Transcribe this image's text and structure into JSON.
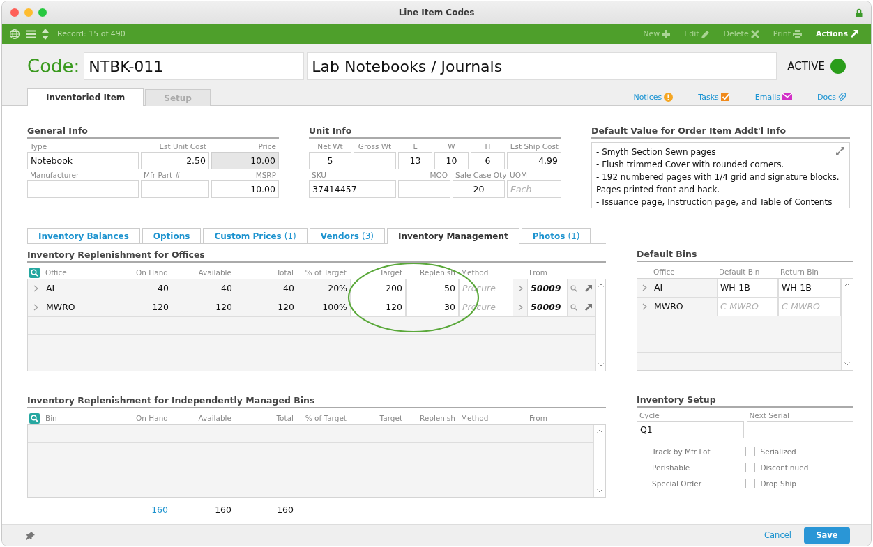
{
  "window": {
    "title": "Line Item Codes"
  },
  "toolbar": {
    "record": "Record: 15 of 490",
    "actions": [
      {
        "label": "New",
        "disabled": true
      },
      {
        "label": "Edit",
        "disabled": true
      },
      {
        "label": "Delete",
        "disabled": true
      },
      {
        "label": "Print",
        "disabled": true
      },
      {
        "label": "Actions",
        "disabled": false
      }
    ]
  },
  "header": {
    "code_label": "Code:",
    "code": "NTBK-011",
    "name": "Lab Notebooks / Journals",
    "status": "ACTIVE",
    "active": true
  },
  "main_tabs": [
    {
      "label": "Inventoried Item",
      "selected": true
    },
    {
      "label": "Setup",
      "selected": false
    }
  ],
  "links": [
    {
      "label": "Notices"
    },
    {
      "label": "Tasks"
    },
    {
      "label": "Emails"
    },
    {
      "label": "Docs"
    }
  ],
  "general_info": {
    "title": "General Info",
    "fields": [
      {
        "label": "Type",
        "value": "Notebook"
      },
      {
        "label": "Est Unit Cost",
        "value": "2.50"
      },
      {
        "label": "Price",
        "value": "10.00",
        "readonly": true
      },
      {
        "label": "Manufacturer",
        "readonly": false
      },
      {
        "label": "Mfr Part #",
        "readonly": false
      },
      {
        "label": "MSRP",
        "value": "10.00",
        "readonly": false
      }
    ]
  },
  "unit_info": {
    "title": "Unit Info",
    "fields": [
      {
        "label": "Net Wt",
        "value": "5"
      },
      {
        "label": "Gross Wt"
      },
      {
        "label": "L",
        "value": "13"
      },
      {
        "label": "W",
        "value": "10"
      },
      {
        "label": "H",
        "value": "6"
      },
      {
        "label": "Est Ship Cost",
        "value": "4.99"
      },
      {
        "label": "SKU",
        "value": "37414457"
      },
      {
        "label": "MOQ"
      },
      {
        "label": "Sale Case Qty",
        "value": "20"
      },
      {
        "label": "UOM",
        "placeholder": "Each"
      }
    ]
  },
  "default_info": {
    "title": "Default Value for Order Item Addt'l Info",
    "lines": [
      "- Smyth Section Sewn pages",
      "- Flush trimmed Cover with rounded corners.",
      "- 192 numbered pages with 1/4 grid and signature blocks.",
      "Pages printed front and back.",
      "- Issuance page, Instruction page, and Table of Contents"
    ]
  },
  "sub_tabs": [
    {
      "label": "Inventory Balances",
      "selected": false
    },
    {
      "label": "Options",
      "selected": false
    },
    {
      "label": "Custom Prices",
      "count": "(1)",
      "selected": false
    },
    {
      "label": "Vendors",
      "count": "(3)",
      "selected": false
    },
    {
      "label": "Inventory Management",
      "selected": true
    },
    {
      "label": "Photos",
      "count": "(1)",
      "selected": false
    }
  ],
  "offices": {
    "title": "Inventory Replenishment for Offices",
    "columns": [
      "Office",
      "On Hand",
      "Available",
      "Total",
      "% of Target",
      "Target",
      "Replenish",
      "Method",
      "From"
    ],
    "rows": [
      {
        "office": "AI",
        "on_hand": "40",
        "available": "40",
        "total": "40",
        "pct": "20%",
        "target": "200",
        "replenish": "50",
        "method_placeholder": "Procure",
        "from": "50009"
      },
      {
        "office": "MWRO",
        "on_hand": "120",
        "available": "120",
        "total": "120",
        "pct": "100%",
        "target": "120",
        "replenish": "30",
        "method_placeholder": "Procure",
        "from": "50009"
      }
    ]
  },
  "default_bins": {
    "title": "Default Bins",
    "columns": [
      "Office",
      "Default Bin",
      "Return Bin"
    ],
    "rows": [
      {
        "office": "AI",
        "default_bin": {
          "value": "WH-1B"
        },
        "return_bin": {
          "value": "WH-1B"
        }
      },
      {
        "office": "MWRO",
        "default_bin": {
          "placeholder": "C-MWRO"
        },
        "return_bin": {
          "placeholder": "C-MWRO"
        }
      }
    ]
  },
  "bins": {
    "title": "Inventory Replenishment for Independently Managed Bins",
    "columns": [
      "Bin",
      "On Hand",
      "Available",
      "Total",
      "% of Target",
      "Target",
      "Replenish",
      "Method",
      "From"
    ],
    "totals": [
      {
        "value": "160",
        "kind": "link"
      },
      {
        "value": "160",
        "kind": "plain"
      },
      {
        "value": "160",
        "kind": "plain"
      }
    ]
  },
  "setup": {
    "title": "Inventory Setup",
    "fields": [
      {
        "label": "Cycle",
        "value": "Q1"
      },
      {
        "label": "Next Serial"
      }
    ],
    "options": [
      {
        "label": "Track by Mfr Lot",
        "checked": false
      },
      {
        "label": "Serialized",
        "checked": false
      },
      {
        "label": "Perishable",
        "checked": false
      },
      {
        "label": "Discontinued",
        "checked": false
      },
      {
        "label": "Special Order",
        "checked": false
      },
      {
        "label": "Drop Ship",
        "checked": false
      }
    ]
  },
  "footer": {
    "cancel": "Cancel",
    "save": "Save"
  }
}
